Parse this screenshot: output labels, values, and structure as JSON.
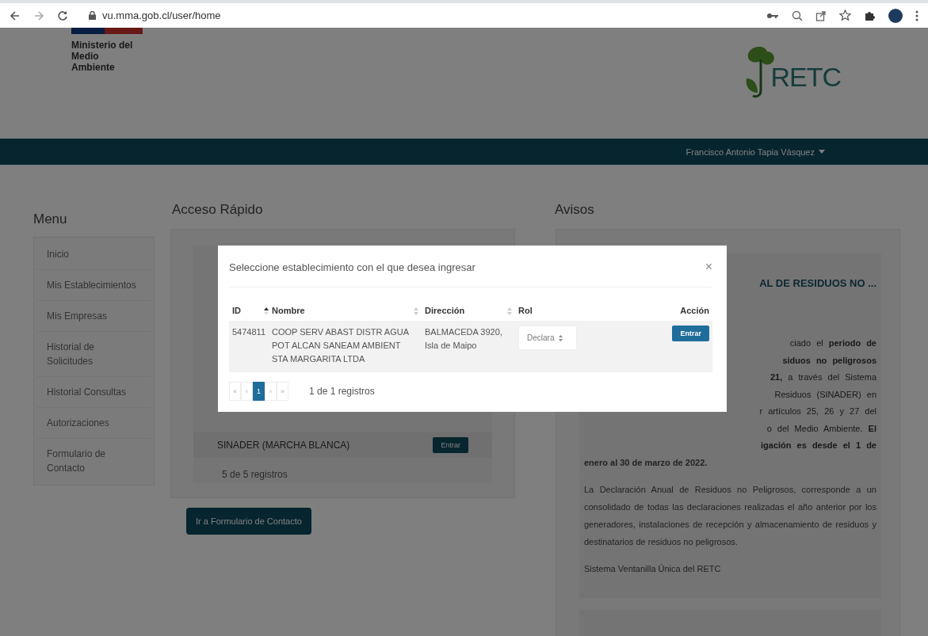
{
  "browser": {
    "url": "vu.mma.gob.cl/user/home"
  },
  "header": {
    "ministry": "Ministerio del\nMedio\nAmbiente",
    "logo_text": "RETC"
  },
  "navbar": {
    "user": "Francisco Antonio Tapia Vásquez"
  },
  "menu": {
    "title": "Menu",
    "items": [
      {
        "label": "Inicio"
      },
      {
        "label": "Mis Establecimientos"
      },
      {
        "label": "Mis Empresas"
      },
      {
        "label": "Historial de Solicitudes"
      },
      {
        "label": "Historial Consultas"
      },
      {
        "label": "Autorizaciones"
      },
      {
        "label": "Formulario de Contacto"
      }
    ]
  },
  "quick_access": {
    "title": "Acceso Rápido",
    "rows": [
      {
        "name": "SINADER (MARCHA BLANCA)",
        "button": "Entrar"
      }
    ],
    "count": "5 de 5 registros",
    "contact_button": "Ir a Formulario de Contacto"
  },
  "notices": {
    "title": "Avisos",
    "card_title": "AL DE RESIDUOS NO ...",
    "partial_lines": [
      {
        "text": "ciado el **periodo de**"
      },
      {
        "text": "**siduos no peligrosos**"
      },
      {
        "text": "**21,** a través del Sistema"
      },
      {
        "text": "Residuos (SINADER) en"
      },
      {
        "text": "r artículos 25, 26 y 27 del"
      },
      {
        "text": "o del Medio Ambiente. **El**"
      },
      {
        "text": "**igación es desde el 1 de**"
      }
    ],
    "paragraphs": [
      "**enero al 30 de marzo de 2022.**",
      "La Declaración Anual de Residuos no Peligrosos, corresponde a un consolidado de todas las declaraciones realizadas el año anterior por los generadores, instalaciones de recepción y almacenamiento de residuos y destinatarios de residuos no peligrosos.",
      "Sistema Ventanilla Única del RETC"
    ]
  },
  "modal": {
    "title": "Seleccione establecimiento con el que desea ingresar",
    "close": "×",
    "columns": [
      {
        "label": "ID",
        "kind": "sorted"
      },
      {
        "label": "Nombre",
        "kind": "sortable"
      },
      {
        "label": "Dirección",
        "kind": "sortable"
      },
      {
        "label": "Rol",
        "kind": "plain"
      },
      {
        "label": "Acción",
        "kind": "plain"
      }
    ],
    "rows": [
      {
        "id": "5474811",
        "name": "COOP SERV ABAST DISTR AGUA POT ALCAN SANEAM AMBIENT STA MARGARITA LTDA",
        "address": "BALMACEDA 3920, Isla de Maipo",
        "role": "Declara",
        "button": "Entrar"
      }
    ],
    "pagination": [
      {
        "label": "«",
        "selected": false
      },
      {
        "label": "‹",
        "selected": false
      },
      {
        "label": "1",
        "selected": true
      },
      {
        "label": "›",
        "selected": false
      },
      {
        "label": "»",
        "selected": false
      }
    ],
    "count": "1 de 1 registros"
  }
}
